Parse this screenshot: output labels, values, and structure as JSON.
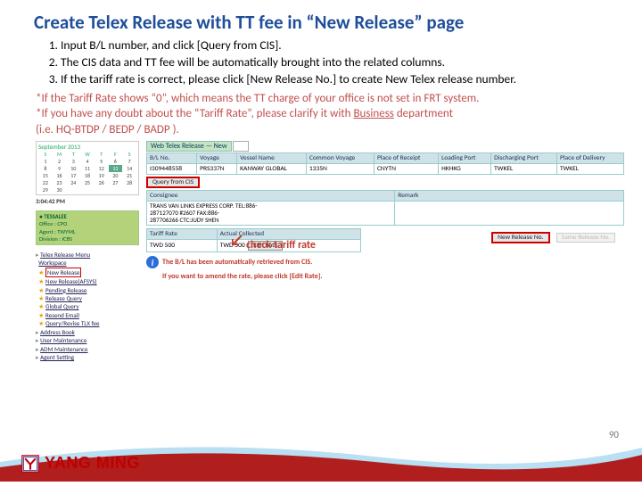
{
  "title": "Create Telex Release with TT fee in “New Release” page",
  "steps": [
    "Input B/L number, and click [Query from CIS].",
    "The CIS data and TT fee will be automatically brought into the related columns.",
    "If the tariff rate is correct, please click [New Release No.] to create New Telex release number."
  ],
  "note1": "*If  the Tariff Rate shows “0”, which means the TT charge of your office is not set in FRT system.",
  "note2a": "*If you have any doubt about the “Tariff Rate”, please clarify it with ",
  "note2b": "Business",
  "note2c": " department",
  "note3": "   (i.e. HQ-BTDP / BEDP / BADP ).",
  "cal": {
    "month": "September 2013",
    "dow": [
      "S",
      "M",
      "T",
      "W",
      "T",
      "F",
      "S"
    ],
    "cells": [
      "1",
      "2",
      "3",
      "4",
      "5",
      "6",
      "7",
      "8",
      "9",
      "10",
      "11",
      "12",
      "13",
      "14",
      "15",
      "16",
      "17",
      "18",
      "19",
      "20",
      "21",
      "22",
      "23",
      "24",
      "25",
      "26",
      "27",
      "28",
      "29",
      "30",
      " "
    ],
    "time": "3:04:42 PM"
  },
  "user": {
    "name": "TESSALEE",
    "office": "Office : CPO",
    "agent": "Agent : TWYML",
    "division": "Division : ICBS"
  },
  "menu": {
    "head": "Telex Release Menu",
    "work": "Workspace",
    "items": [
      "New Release",
      "New Release(AFSYS)",
      "Pending Release",
      "Release Query",
      "Global Query",
      "Resend Email",
      "Query/Revise TLX fee"
    ],
    "tri": [
      "Address Book",
      "User Maintenance",
      "ADM Maintenance",
      "Agent Setting"
    ]
  },
  "tab1": "Web Telex Release — New",
  "headers": [
    "B/L No.",
    "Voyage",
    "Vessel Name",
    "Common Voyage",
    "Place of Receipt",
    "Loading Port",
    "Discharging Port",
    "Place of Delivery"
  ],
  "row": [
    "I309448558",
    "PRS337N",
    "KANWAY GLOBAL",
    "1335N",
    "CNYTN",
    "HKHKG",
    "TWKEL",
    "TWKEL"
  ],
  "query_btn": "Query from CIS",
  "sec2": [
    "Consignee",
    "Remark"
  ],
  "consignee": "TRANS VAN LINKS EXPRESS CORP.  TEL:886-\n287127070 #2607        FAX:886-\n287706266             CTC:JUDY SHEN",
  "rates_h": [
    "Tariff Rate",
    "Actual Collected"
  ],
  "rates": [
    "TWD  500",
    "TWD  500"
  ],
  "edit_btn": "Edit Rate",
  "newrel_btn": "New Release No.",
  "samerel_btn": "Same Release No.",
  "info1": "The B/L has been automatically retrieved from CIS.",
  "info2": "If you want to amend the rate, please click [Edit Rate].",
  "callout": "check tariff rate",
  "page": "90",
  "brand": "YANG  MING"
}
